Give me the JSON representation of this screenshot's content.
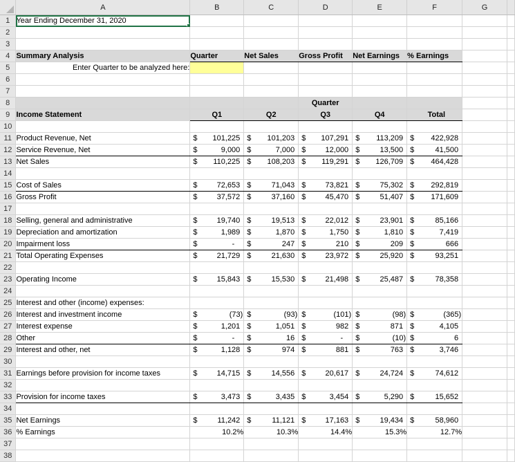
{
  "columns": [
    "A",
    "B",
    "C",
    "D",
    "E",
    "F",
    "G"
  ],
  "selected_cell": "A1",
  "title": "Year Ending December 31, 2020",
  "summary": {
    "label": "Summary Analysis",
    "headers": [
      "Quarter",
      "Net Sales",
      "Gross Profit",
      "Net Earnings",
      "% Earnings"
    ],
    "prompt": "Enter Quarter to be analyzed here:",
    "quarter_input": ""
  },
  "income_statement": {
    "label": "Income Statement",
    "group_header": "Quarter",
    "headers": [
      "Q1",
      "Q2",
      "Q3",
      "Q4",
      "Total"
    ],
    "currency": "$",
    "rows": [
      {
        "row": 11,
        "label": "Product Revenue, Net",
        "values": [
          "101,225",
          "101,203",
          "107,291",
          "113,209",
          "422,928"
        ]
      },
      {
        "row": 12,
        "label": "Service Revenue, Net",
        "values": [
          "9,000",
          "7,000",
          "12,000",
          "13,500",
          "41,500"
        ]
      },
      {
        "row": 13,
        "label": "Net Sales",
        "values": [
          "110,225",
          "108,203",
          "119,291",
          "126,709",
          "464,428"
        ]
      },
      {
        "row": 15,
        "label": "Cost of Sales",
        "values": [
          "72,653",
          "71,043",
          "73,821",
          "75,302",
          "292,819"
        ]
      },
      {
        "row": 16,
        "label": "Gross Profit",
        "values": [
          "37,572",
          "37,160",
          "45,470",
          "51,407",
          "171,609"
        ]
      },
      {
        "row": 18,
        "label": "Selling, general and administrative",
        "values": [
          "19,740",
          "19,513",
          "22,012",
          "23,901",
          "85,166"
        ]
      },
      {
        "row": 19,
        "label": "Depreciation and amortization",
        "values": [
          "1,989",
          "1,870",
          "1,750",
          "1,810",
          "7,419"
        ]
      },
      {
        "row": 20,
        "label": "Impairment loss",
        "values": [
          "-",
          "247",
          "210",
          "209",
          "666"
        ]
      },
      {
        "row": 21,
        "label": "Total Operating Expenses",
        "values": [
          "21,729",
          "21,630",
          "23,972",
          "25,920",
          "93,251"
        ]
      },
      {
        "row": 23,
        "label": "Operating Income",
        "values": [
          "15,843",
          "15,530",
          "21,498",
          "25,487",
          "78,358"
        ]
      },
      {
        "row": 25,
        "label": "Interest and other (income) expenses:",
        "values": null
      },
      {
        "row": 26,
        "label": "Interest and investment income",
        "values": [
          "(73)",
          "(93)",
          "(101)",
          "(98)",
          "(365)"
        ]
      },
      {
        "row": 27,
        "label": "Interest expense",
        "values": [
          "1,201",
          "1,051",
          "982",
          "871",
          "4,105"
        ]
      },
      {
        "row": 28,
        "label": "Other",
        "values": [
          "-",
          "16",
          "-",
          "(10)",
          "6"
        ]
      },
      {
        "row": 29,
        "label": "Interest and other, net",
        "values": [
          "1,128",
          "974",
          "881",
          "763",
          "3,746"
        ]
      },
      {
        "row": 31,
        "label": "Earnings before provision for income taxes",
        "values": [
          "14,715",
          "14,556",
          "20,617",
          "24,724",
          "74,612"
        ]
      },
      {
        "row": 33,
        "label": "Provision for income taxes",
        "values": [
          "3,473",
          "3,435",
          "3,454",
          "5,290",
          "15,652"
        ]
      },
      {
        "row": 35,
        "label": "Net Earnings",
        "values": [
          "11,242",
          "11,121",
          "17,163",
          "19,434",
          "58,960"
        ]
      },
      {
        "row": 36,
        "label": "% Earnings",
        "percent": [
          "10.2%",
          "10.3%",
          "14.4%",
          "15.3%",
          "12.7%"
        ]
      }
    ]
  }
}
